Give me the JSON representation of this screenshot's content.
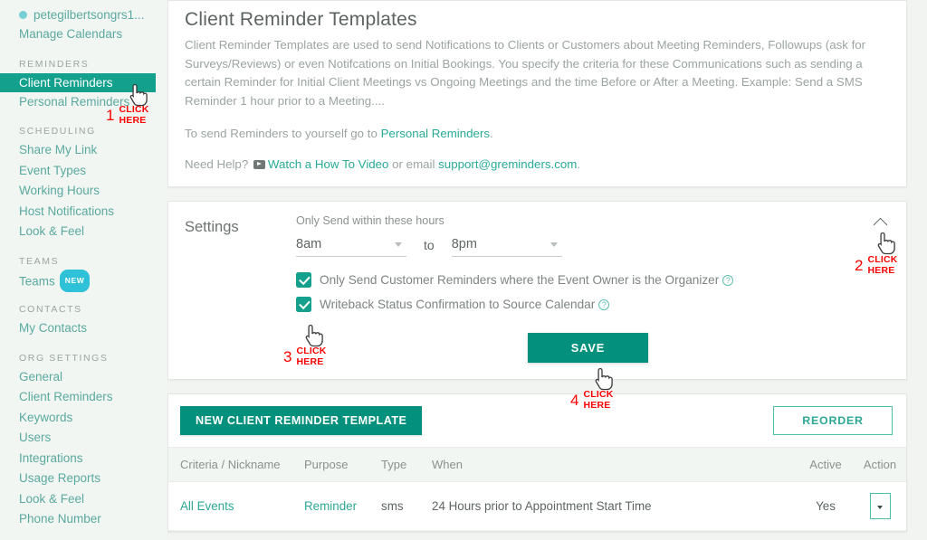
{
  "sidebar": {
    "user": {
      "name": "petegilbertsongrs1...",
      "dot_color": "#76cfd4"
    },
    "manage_calendars": "Manage Calendars",
    "sections": [
      {
        "title": "REMINDERS",
        "items": [
          {
            "label": "Client Reminders",
            "active": true
          },
          {
            "label": "Personal Reminders",
            "active": false
          }
        ]
      },
      {
        "title": "SCHEDULING",
        "items": [
          {
            "label": "Share My Link",
            "active": false
          },
          {
            "label": "Event Types",
            "active": false
          },
          {
            "label": "Working Hours",
            "active": false
          },
          {
            "label": "Host Notifications",
            "active": false
          },
          {
            "label": "Look & Feel",
            "active": false
          }
        ]
      },
      {
        "title": "TEAMS",
        "items": [
          {
            "label": "Teams",
            "active": false,
            "badge": "NEW"
          }
        ]
      },
      {
        "title": "CONTACTS",
        "items": [
          {
            "label": "My Contacts",
            "active": false
          }
        ]
      },
      {
        "title": "ORG SETTINGS",
        "items": [
          {
            "label": "General",
            "active": false
          },
          {
            "label": "Client Reminders",
            "active": false
          },
          {
            "label": "Keywords",
            "active": false
          },
          {
            "label": "Users",
            "active": false
          },
          {
            "label": "Integrations",
            "active": false
          },
          {
            "label": "Usage Reports",
            "active": false
          },
          {
            "label": "Look & Feel",
            "active": false
          },
          {
            "label": "Phone Number",
            "active": false
          }
        ]
      }
    ]
  },
  "header": {
    "title": "Client Reminder Templates",
    "description": "Client Reminder Templates are used to send Notifications to Clients or Customers about Meeting Reminders, Followups (ask for Surveys/Reviews) or even Notifcations on Initial Bookings. You specify the criteria for these Communications such as sending a certain Reminder for Initial Client Meetings vs Ongoing Meetings and the time Before or After a Meeting. Example: Send a SMS Reminder 1 hour prior to a Meeting....",
    "personal_line_prefix": "To send Reminders to yourself go to ",
    "personal_link": "Personal Reminders",
    "personal_line_suffix": ".",
    "help_prefix": "Need Help? ",
    "video_link": "Watch a How To Video",
    "help_middle": " or email ",
    "support_email": "support@greminders.com",
    "help_suffix": "."
  },
  "settings": {
    "title": "Settings",
    "subtitle": "Only Send within these hours",
    "from_value": "8am",
    "to_word": "to",
    "to_value": "8pm",
    "checkbox_1": {
      "label": "Only Send Customer Reminders where the Event Owner is the Organizer",
      "checked": true,
      "help": "?"
    },
    "checkbox_2": {
      "label": "Writeback Status Confirmation to Source Calendar",
      "checked": true,
      "help": "?"
    },
    "save_label": "SAVE",
    "collapse_label": "collapse"
  },
  "templates": {
    "new_button": "NEW CLIENT REMINDER TEMPLATE",
    "reorder_button": "REORDER",
    "columns": [
      "Criteria / Nickname",
      "Purpose",
      "Type",
      "When",
      "Active",
      "Action"
    ],
    "rows": [
      {
        "criteria": "All Events",
        "purpose": "Reminder",
        "type": "sms",
        "when": "24 Hours prior to Appointment Start Time",
        "active": "Yes",
        "action": "▾"
      }
    ]
  },
  "annotations": {
    "color": "#ff0000",
    "items": [
      {
        "number": "1",
        "line1": "CLICK",
        "line2": "HERE"
      },
      {
        "number": "2",
        "line1": "CLICK",
        "line2": "HERE"
      },
      {
        "number": "3",
        "line1": "CLICK",
        "line2": "HERE"
      },
      {
        "number": "4",
        "line1": "CLICK",
        "line2": "HERE"
      }
    ]
  },
  "colors": {
    "accent": "#13a08c",
    "primary_button": "#03907d",
    "link": "#27ab96",
    "sidebar_bg": "#f2f6f2",
    "page_bg": "#f2f4f2",
    "badge": "#2ec1d8"
  }
}
